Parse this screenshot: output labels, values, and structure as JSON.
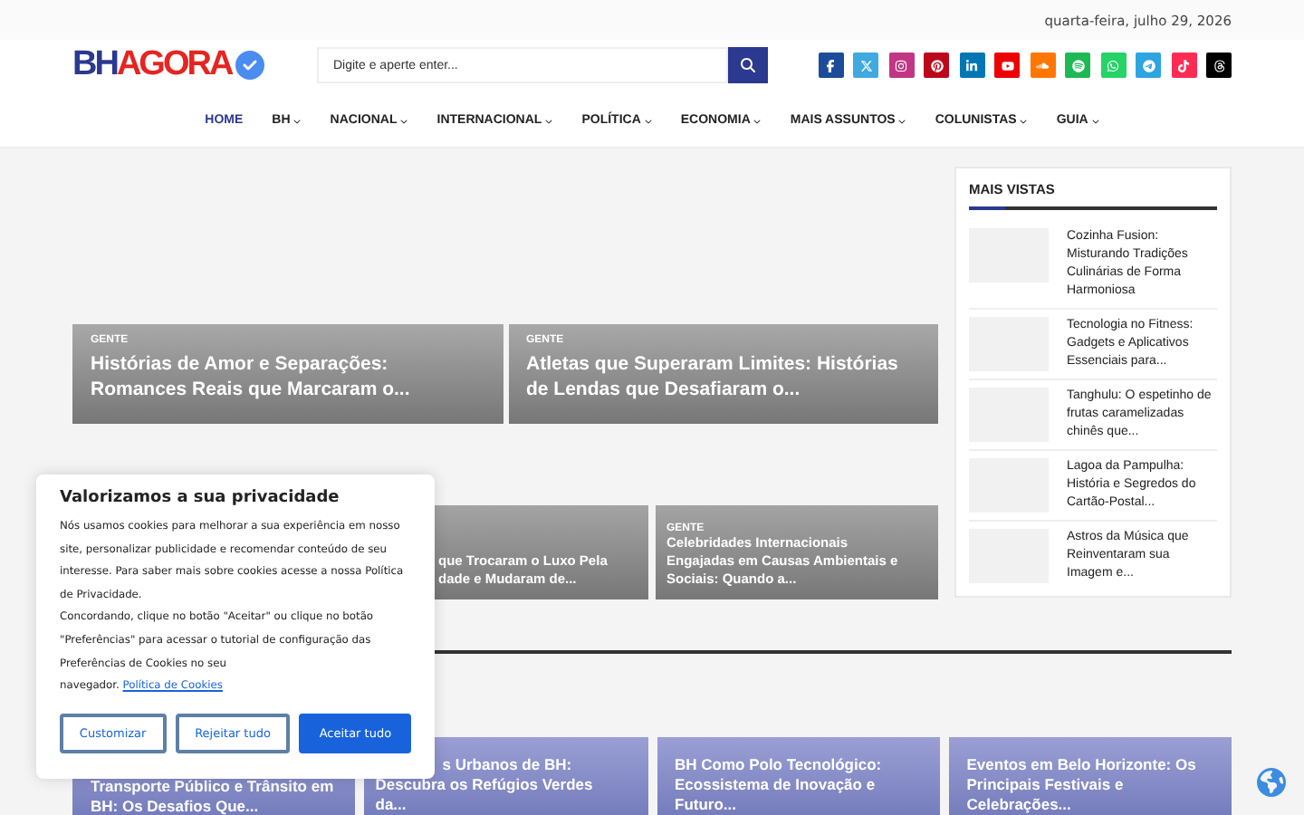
{
  "top_bar": {
    "date": "quarta-feira, julho 29, 2026"
  },
  "logo": {
    "part_1": "BH",
    "part_2": "AGORA"
  },
  "search": {
    "placeholder": "Digite e aperte enter..."
  },
  "nav": [
    {
      "label": "HOME",
      "selected": true,
      "has_menu": false
    },
    {
      "label": "BH",
      "selected": false,
      "has_menu": true
    },
    {
      "label": "NACIONAL",
      "selected": false,
      "has_menu": true
    },
    {
      "label": "INTERNACIONAL",
      "selected": false,
      "has_menu": true
    },
    {
      "label": "POLÍTICA",
      "selected": false,
      "has_menu": true
    },
    {
      "label": "ECONOMIA",
      "selected": false,
      "has_menu": true
    },
    {
      "label": "MAIS ASSUNTOS",
      "selected": false,
      "has_menu": true
    },
    {
      "label": "COLUNISTAS",
      "selected": false,
      "has_menu": true
    },
    {
      "label": "GUIA",
      "selected": false,
      "has_menu": true
    }
  ],
  "featured_row_1": [
    {
      "category": "GENTE",
      "title": "Histórias de Amor e Separações: Romances Reais que Marcaram o..."
    },
    {
      "category": "GENTE",
      "title": "Atletas que Superaram Limites: Histórias de Lendas que Desafiaram o..."
    }
  ],
  "featured_row_2": [
    {
      "title_lines": [
        "que Trocaram o Luxo Pela",
        "dade e Mudaram de..."
      ]
    },
    {
      "category": "GENTE",
      "title_lines": [
        "Celebridades Internacionais",
        "Engajadas em Causas Ambientais e",
        "Sociais: Quando a..."
      ]
    }
  ],
  "sidebar": {
    "title": "MAIS VISTAS",
    "items": [
      {
        "title": "Cozinha Fusion: Misturando Tradições Culinárias de Forma Harmoniosa"
      },
      {
        "title": "Tecnologia no Fitness: Gadgets e Aplicativos Essenciais para..."
      },
      {
        "title": "Tanghulu: O espetinho de frutas caramelizadas chinês que..."
      },
      {
        "title": "Lagoa da Pampulha: História e Segredos do Cartão-Postal..."
      },
      {
        "title": "Astros da Música que Reinventaram sua Imagem e..."
      }
    ]
  },
  "bottom_row": [
    {
      "title_lines": [
        "Transporte Público e Trânsito em",
        "BH: Os Desafios Que..."
      ]
    },
    {
      "title_lines": [
        "s Urbanos de BH:",
        "Descubra os Refúgios Verdes",
        "da..."
      ]
    },
    {
      "title_lines": [
        "BH Como Polo Tecnológico:",
        "Ecossistema de Inovação e",
        "Futuro..."
      ]
    },
    {
      "title_lines": [
        "Eventos em Belo Horizonte: Os",
        "Principais Festivais e",
        "Celebrações..."
      ]
    }
  ],
  "cookie_dialog": {
    "title": "Valorizamos a sua privacidade",
    "body_1": "Nós usamos cookies para melhorar a sua experiência em nosso site, personalizar publicidade e recomendar conteúdo de seu interesse. Para saber mais sobre cookies acesse a nossa Política de Privacidade.",
    "body_2": "Concordando, clique no botão \"Aceitar\" ou clique no botão \"Preferências\" para acessar o tutorial de configuração das Preferências de Cookies no seu",
    "body_3": "navegador.",
    "link": "Política de Cookies",
    "buttons": [
      {
        "label": "Customizar",
        "primary": false
      },
      {
        "label": "Rejeitar tudo",
        "primary": false
      },
      {
        "label": "Aceitar tudo",
        "primary": true
      }
    ]
  }
}
